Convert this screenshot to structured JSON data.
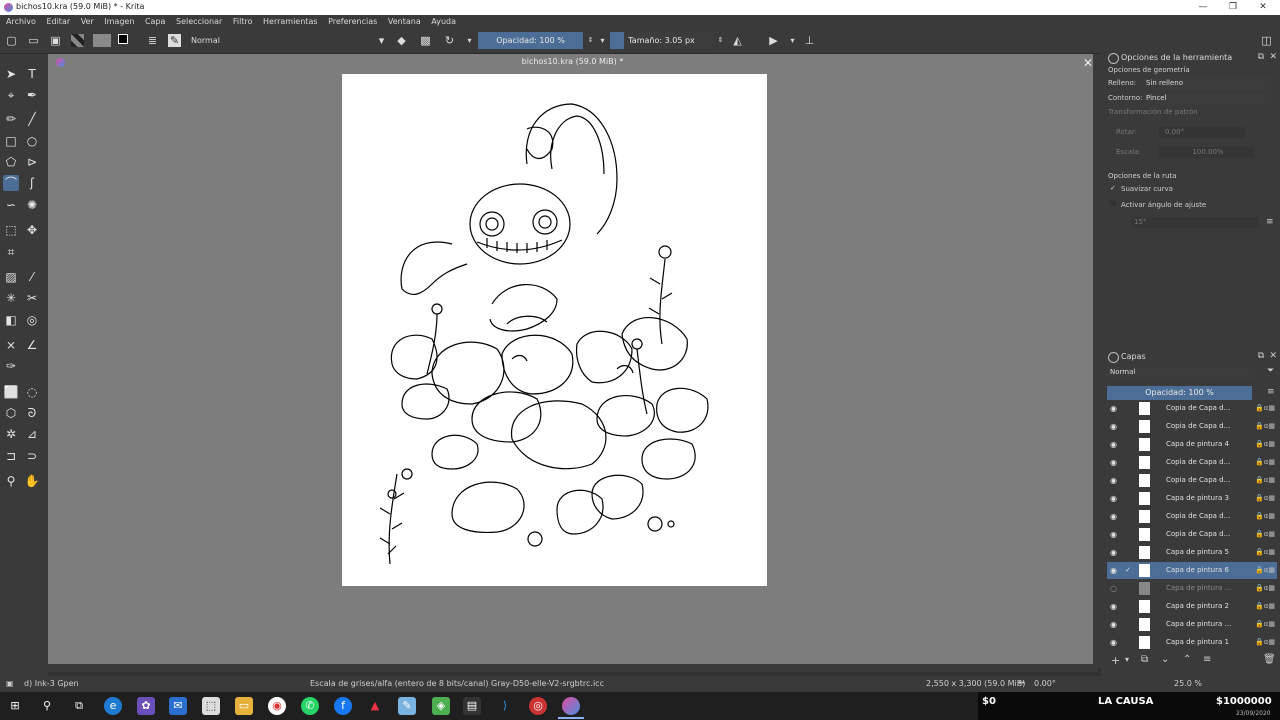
{
  "window": {
    "title": "bichos10.kra (59.0 MiB) * - Krita",
    "minimize": "—",
    "maximize": "❐",
    "close": "✕"
  },
  "menu": [
    "Archivo",
    "Editar",
    "Ver",
    "Imagen",
    "Capa",
    "Seleccionar",
    "Filtro",
    "Herramientas",
    "Preferencias",
    "Ventana",
    "Ayuda"
  ],
  "toolbar": {
    "blend_mode": "Normal",
    "opacity": "Opacidad: 100 %",
    "size": "Tamaño: 3.05 px"
  },
  "document": {
    "tab_title": "bichos10.kra (59.0 MiB) *"
  },
  "tool_options": {
    "title": "Opciones de la herramienta",
    "geometry": "Opciones de geometría",
    "fill_label": "Relleno:",
    "fill_value": "Sin relleno",
    "outline_label": "Contorno:",
    "outline_value": "Pincel",
    "pattern": "Transformación de patrón",
    "rotate_label": "Rotar:",
    "rotate_value": "0.00°",
    "scale_label": "Escala:",
    "scale_value": "100.00%",
    "path_options": "Opciones de la ruta",
    "smooth": "Suavizar curva",
    "snap": "Activar ángulo de ajuste",
    "snap_value": "15°"
  },
  "layers": {
    "title": "Capas",
    "blend": "Normal",
    "opacity": "Opacidad: 100 %",
    "items": [
      {
        "name": "Copia de Capa d...",
        "selected": false,
        "hidden": false
      },
      {
        "name": "Copia de Capa d...",
        "selected": false,
        "hidden": false
      },
      {
        "name": "Capa de pintura 4",
        "selected": false,
        "hidden": false
      },
      {
        "name": "Copia de Capa d...",
        "selected": false,
        "hidden": false
      },
      {
        "name": "Copia de Capa d...",
        "selected": false,
        "hidden": false
      },
      {
        "name": "Capa de pintura 3",
        "selected": false,
        "hidden": false
      },
      {
        "name": "Copia de Capa d...",
        "selected": false,
        "hidden": false
      },
      {
        "name": "Copia de Capa d...",
        "selected": false,
        "hidden": false
      },
      {
        "name": "Capa de pintura 5",
        "selected": false,
        "hidden": false
      },
      {
        "name": "Capa de pintura 6",
        "selected": true,
        "hidden": false
      },
      {
        "name": "Capa de pintura ...",
        "selected": false,
        "hidden": true
      },
      {
        "name": "Capa de pintura 2",
        "selected": false,
        "hidden": false
      },
      {
        "name": "Capa de pintura ...",
        "selected": false,
        "hidden": false
      },
      {
        "name": "Capa de pintura 1",
        "selected": false,
        "hidden": false
      }
    ]
  },
  "status": {
    "brush": "d) Ink-3 Gpen",
    "colorspace": "Escala de grises/alfa (entero de 8 bits/canal)  Gray-D50-elle-V2-srgbtrc.icc",
    "dimensions": "2,550 x 3,300 (59.0 MiB)",
    "rotation": "0.00°",
    "zoom": "25.0 %"
  },
  "overlay": {
    "left": "$0",
    "middle": "LA CAUSA",
    "right": "$1000000",
    "date": "23/09/2020"
  }
}
